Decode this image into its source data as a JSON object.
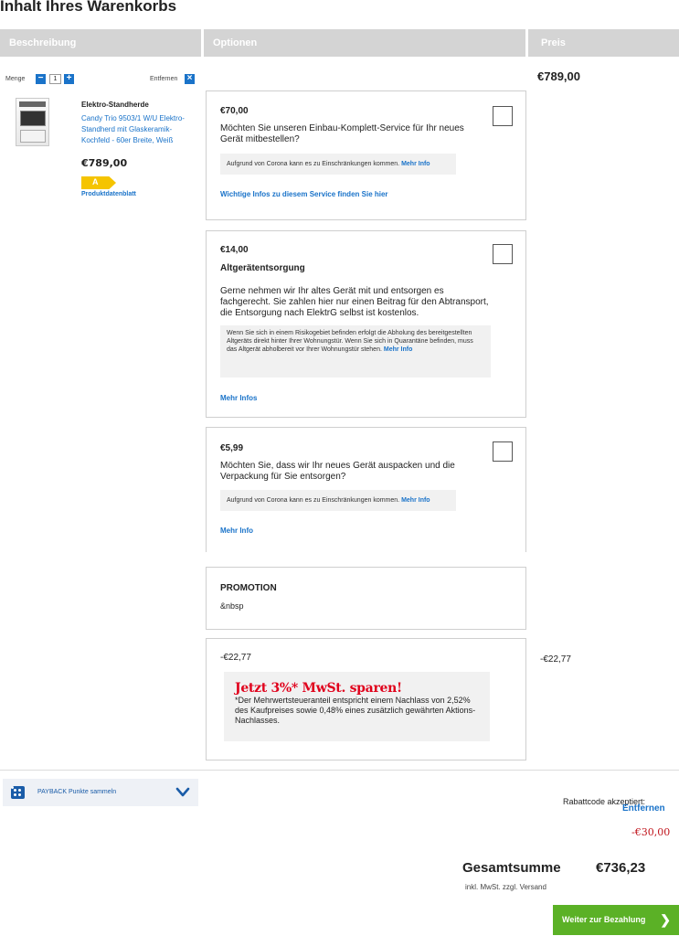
{
  "page": {
    "title": "Inhalt Ihres Warenkorbs"
  },
  "columns": {
    "description": "Beschreibung",
    "options": "Optionen",
    "price": "Preis"
  },
  "item": {
    "quantity_label": "Menge",
    "quantity": "1",
    "minus": "−",
    "plus": "+",
    "remove_label": "Entfernen",
    "remove_symbol": "×",
    "category": "Elektro-Standherde",
    "name": "Candy Trio 9503/1 W/U Elektro-Standherd mit Glaskeramik-Kochfeld - 60er Breite, Weiß",
    "price": "€789,00",
    "energy_class": "A",
    "datasheet": "Produktdatenblatt",
    "line_price": "€789,00"
  },
  "options": [
    {
      "price": "€70,00",
      "text": "Möchten Sie unseren Einbau-Komplett-Service für Ihr neues Gerät mitbestellen?",
      "note": "Aufgrund von Corona kann es zu Einschränkungen kommen.",
      "note_more": "Mehr Info",
      "link": "Wichtige Infos zu diesem Service finden Sie hier"
    },
    {
      "price": "€14,00",
      "title": "Altgerätentsorgung",
      "text": "Gerne nehmen wir Ihr altes Gerät mit und entsorgen es fachgerecht. Sie zahlen hier nur einen Beitrag für den Abtransport, die Entsorgung nach ElektrG selbst ist kostenlos.",
      "note": "Wenn Sie sich in einem Risikogebiet befinden erfolgt die Abholung des bereitgestellten Altgeräts direkt hinter Ihrer Wohnungstür. Wenn Sie sich in Quarantäne befinden, muss das Altgerät abholbereit vor Ihrer Wohnungstür stehen.",
      "note_more": "Mehr Info",
      "link": "Mehr Infos"
    },
    {
      "price": "€5,99",
      "text": "Möchten Sie, dass wir Ihr neues Gerät auspacken und die Verpackung für Sie entsorgen?",
      "note": "Aufgrund von Corona kann es zu Einschränkungen kommen.",
      "note_more": "Mehr Info",
      "link": "Mehr Info"
    }
  ],
  "promotion": {
    "title": "PROMOTION",
    "text": "&nbsp"
  },
  "discount": {
    "amount": "-€22,77",
    "headline": "Jetzt 3%* MwSt. sparen!",
    "text": "*Der Mehrwertsteueranteil entspricht einem Nachlass von 2,52% des Kaufpreises sowie 0,48% eines zusätzlich gewährten Aktions-Nachlasses.",
    "right_amount": "-€22,77"
  },
  "payback": {
    "label": "PAYBACK Punkte sammeln"
  },
  "coupon": {
    "accepted": "Rabattcode akzeptiert:",
    "remove": "Entfernen",
    "amount": "-€30,00"
  },
  "total": {
    "label": "Gesamtsumme",
    "value": "€736,23",
    "note": "inkl. MwSt. zzgl. Versand"
  },
  "checkout": {
    "label": "Weiter zur Bezahlung",
    "arrow": "❯"
  },
  "colors": {
    "link": "#1a73c9",
    "button": "#5bb126",
    "header": "#d4d4d4",
    "discount": "#c0141c"
  }
}
